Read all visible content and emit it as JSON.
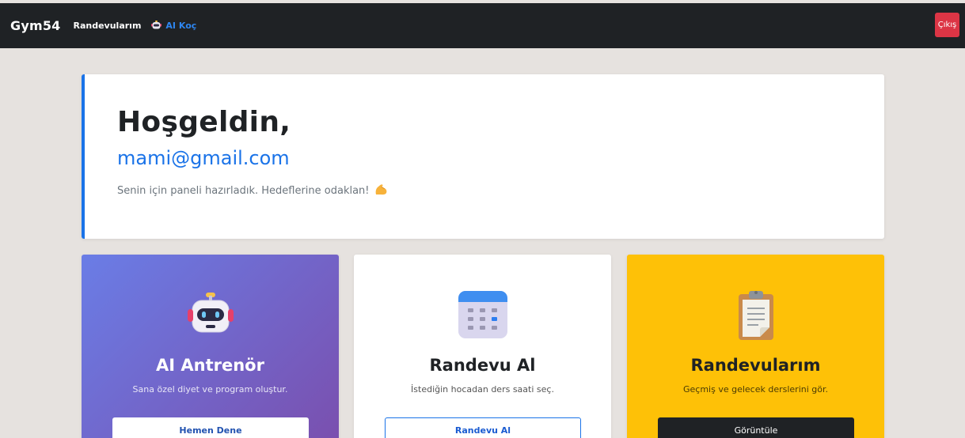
{
  "navbar": {
    "brand": "Gym54",
    "appointments_link": "Randevularım",
    "ai_coach_link": "AI Koç",
    "logout_label": "Çıkış"
  },
  "welcome": {
    "greeting": "Hoşgeldin,",
    "email": "mami@gmail.com",
    "subtitle": "Senin için paneli hazırladık. Hedeflerine odaklan!"
  },
  "cards": [
    {
      "title": "AI Antrenör",
      "description": "Sana özel diyet ve program oluştur.",
      "button_label": "Hemen Dene",
      "icon": "robot-icon"
    },
    {
      "title": "Randevu Al",
      "description": "İstediğin hocadan ders saati seç.",
      "button_label": "Randevu Al",
      "icon": "calendar-icon"
    },
    {
      "title": "Randevularım",
      "description": "Geçmiş ve gelecek derslerini gör.",
      "button_label": "Görüntüle",
      "icon": "clipboard-icon"
    }
  ],
  "colors": {
    "navbar_bg": "#1f2225",
    "accent_blue": "#1a73e8",
    "logout_red": "#dc3545",
    "ai_card_gradient_start": "#6a7de6",
    "ai_card_gradient_end": "#7a4fae",
    "appointments_card_bg": "#fec107"
  }
}
